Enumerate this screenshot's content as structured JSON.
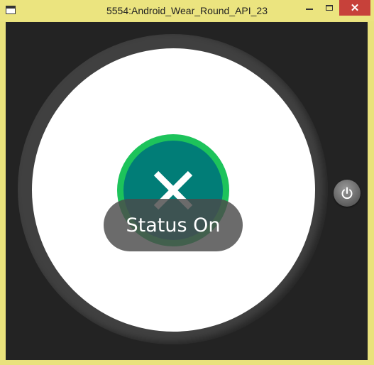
{
  "window": {
    "title": "5554:Android_Wear_Round_API_23",
    "controls": {
      "minimize": "minimize",
      "maximize": "maximize",
      "close": "✕"
    }
  },
  "watch": {
    "action_icon": "close-x-icon",
    "toast_text": "Status On",
    "power_icon": "power-icon"
  },
  "colors": {
    "title_bar": "#ebe47f",
    "close_button": "#c7413a",
    "screen_background": "#232323",
    "bezel": "#404040",
    "watch_face": "#ffffff",
    "action_ring": "#1dc35b",
    "action_fill": "#017d77",
    "toast_background": "#4b4b4b"
  }
}
